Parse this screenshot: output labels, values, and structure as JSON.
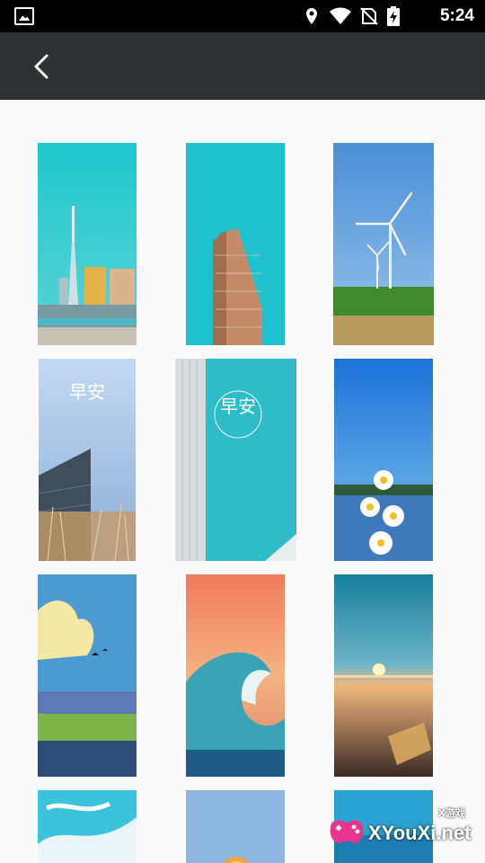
{
  "status_bar": {
    "time": "5:24",
    "icons": [
      "image-notification-icon",
      "location-icon",
      "wifi-icon",
      "no-sim-icon",
      "battery-charging-icon"
    ]
  },
  "toolbar": {
    "back_icon": "chevron-left-icon"
  },
  "wallpapers": [
    {
      "name": "city-tower-teal"
    },
    {
      "name": "flatiron-building-teal"
    },
    {
      "name": "wind-turbines-field"
    },
    {
      "name": "good-morning-building-reeds",
      "text": "早安"
    },
    {
      "name": "good-morning-teal-building",
      "text": "早安"
    },
    {
      "name": "daisies-lake"
    },
    {
      "name": "illustrated-landscape-clouds"
    },
    {
      "name": "wave-sunset"
    },
    {
      "name": "sunset-beach-bottle"
    },
    {
      "name": "sky-clouds-illustration"
    },
    {
      "name": "orange-slice-blue"
    },
    {
      "name": "ocean-sky"
    }
  ],
  "watermark": {
    "text": "XYouXi.net",
    "small_text": "X游戏"
  },
  "colors": {
    "toolbar": "#2f3133",
    "background": "#fafafa",
    "status_bar": "#000000"
  }
}
